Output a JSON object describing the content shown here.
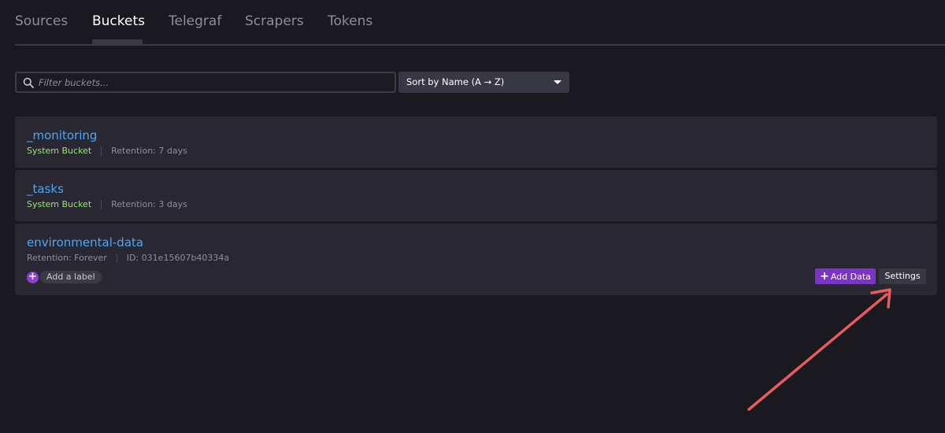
{
  "tabs": [
    {
      "label": "Sources",
      "active": false
    },
    {
      "label": "Buckets",
      "active": true
    },
    {
      "label": "Telegraf",
      "active": false
    },
    {
      "label": "Scrapers",
      "active": false
    },
    {
      "label": "Tokens",
      "active": false
    }
  ],
  "filter": {
    "placeholder": "Filter buckets...",
    "value": ""
  },
  "sort": {
    "label": "Sort by Name (A → Z)"
  },
  "buckets": [
    {
      "name": "_monitoring",
      "type": "System Bucket",
      "retention": "Retention: 7 days"
    },
    {
      "name": "_tasks",
      "type": "System Bucket",
      "retention": "Retention: 3 days"
    },
    {
      "name": "environmental-data",
      "retention": "Retention: Forever",
      "id": "ID: 031e15607b40334a",
      "add_label": "Add a label",
      "add_data": "Add Data",
      "settings": "Settings"
    }
  ],
  "colors": {
    "accent": "#7b34c8",
    "link": "#4ba7f5",
    "system": "#9be277",
    "annotation_arrow": "#e85c5c"
  }
}
